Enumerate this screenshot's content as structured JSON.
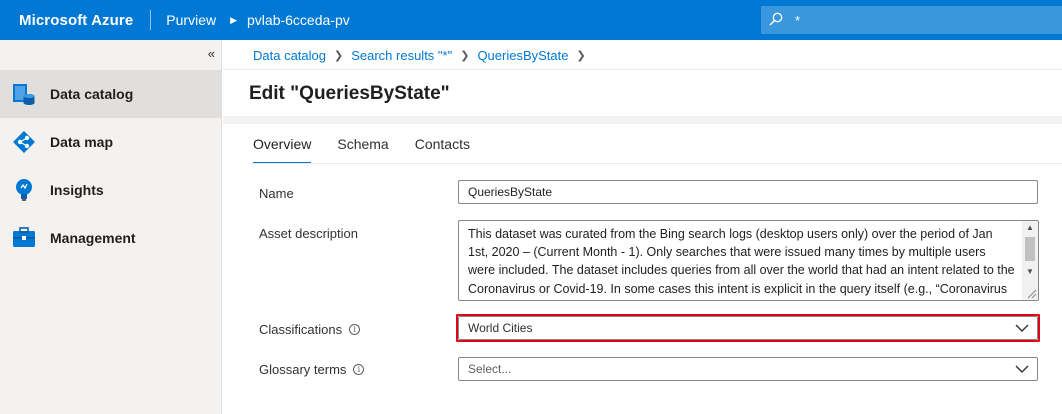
{
  "topbar": {
    "brand": "Microsoft Azure",
    "service": "Purview",
    "instance": "pvlab-6cceda-pv",
    "search_value": "*"
  },
  "sidebar": {
    "items": [
      {
        "label": "Data catalog",
        "icon": "data-catalog-icon",
        "active": true
      },
      {
        "label": "Data map",
        "icon": "data-map-icon"
      },
      {
        "label": "Insights",
        "icon": "insights-icon"
      },
      {
        "label": "Management",
        "icon": "management-icon"
      }
    ]
  },
  "breadcrumb": [
    "Data catalog",
    "Search results \"*\"",
    "QueriesByState"
  ],
  "page": {
    "title": "Edit \"QueriesByState\""
  },
  "tabs": [
    "Overview",
    "Schema",
    "Contacts"
  ],
  "form": {
    "name_label": "Name",
    "name_value": "QueriesByState",
    "description_label": "Asset description",
    "description_value": "This dataset was curated from the Bing search logs (desktop users only) over the period of Jan 1st, 2020 – (Current Month - 1). Only searches that were issued many times by multiple users were included. The dataset includes queries from all over the world that had an intent related to the Coronavirus or Covid-19. In some cases this intent is explicit in the query itself (e.g., “Coronavirus updates Seattle”), in other cases it is implicit , e.g. “Shelter in place”",
    "classifications_label": "Classifications",
    "classifications_value": "World Cities",
    "glossary_label": "Glossary terms",
    "glossary_placeholder": "Select..."
  },
  "colors": {
    "accent": "#0078d4",
    "highlight": "#e3001b"
  }
}
